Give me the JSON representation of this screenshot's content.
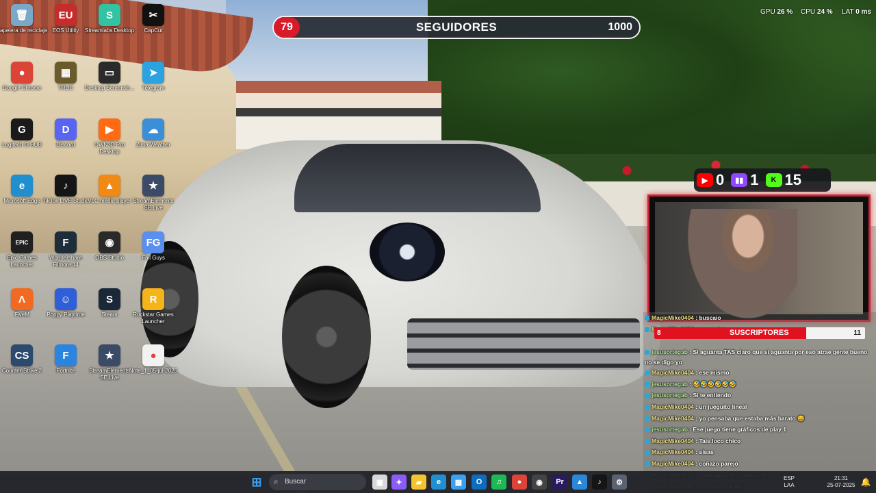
{
  "desktop_icons": [
    {
      "label": "Papelera de reciclaje",
      "icon": "recycle-bin-icon",
      "color": "#7aa8c8",
      "glyph": "🗑"
    },
    {
      "label": "EOS Utility",
      "icon": "eos-utility-icon",
      "color": "#c72c2c",
      "glyph": "EU"
    },
    {
      "label": "Streamlabs Desktop",
      "icon": "streamlabs-icon",
      "color": "#31c3a2",
      "glyph": "S"
    },
    {
      "label": "CapCut",
      "icon": "capcut-icon",
      "color": "#111111",
      "glyph": "✂"
    },
    {
      "label": "Google Chrome",
      "icon": "chrome-icon",
      "color": "#db4437",
      "glyph": "●"
    },
    {
      "label": "TRUC",
      "icon": "truc-icon",
      "color": "#6b5a2c",
      "glyph": "▦"
    },
    {
      "label": "Desktop Screensh...",
      "icon": "screenshot-icon",
      "color": "#2b2b2b",
      "glyph": "▭"
    },
    {
      "label": "Telegram",
      "icon": "telegram-icon",
      "color": "#2aa3e0",
      "glyph": "➤"
    },
    {
      "label": "Logitech G HUB",
      "icon": "logitech-icon",
      "color": "#1a1a1a",
      "glyph": "G"
    },
    {
      "label": "Discord",
      "icon": "discord-icon",
      "color": "#5865f2",
      "glyph": "D"
    },
    {
      "label": "OWN3D Pro Desktop",
      "icon": "own3d-icon",
      "color": "#ff6a13",
      "glyph": "▶"
    },
    {
      "label": "Zima Weather",
      "icon": "weather-icon",
      "color": "#3a8fd8",
      "glyph": "☁"
    },
    {
      "label": "Microsoft Edge",
      "icon": "edge-icon",
      "color": "#1f8fcf",
      "glyph": "e"
    },
    {
      "label": "TikTok LIVE Studio",
      "icon": "tiktok-icon",
      "color": "#151515",
      "glyph": "♪"
    },
    {
      "label": "VLC media player",
      "icon": "vlc-icon",
      "color": "#f08a14",
      "glyph": "▲"
    },
    {
      "label": "StreamElements SE.Live",
      "icon": "streamelements-icon",
      "color": "#3b4a66",
      "glyph": "★"
    },
    {
      "label": "Epic Games Launcher",
      "icon": "epic-games-icon",
      "color": "#202020",
      "glyph": "EPIC"
    },
    {
      "label": "Wondershare Filmora 14",
      "icon": "filmora-icon",
      "color": "#1d2d3a",
      "glyph": "F"
    },
    {
      "label": "OBS Studio",
      "icon": "obs-icon",
      "color": "#2a2a2a",
      "glyph": "◉"
    },
    {
      "label": "Fall Guys",
      "icon": "fall-guys-icon",
      "color": "#5a8ff0",
      "glyph": "FG"
    },
    {
      "label": "FiveM",
      "icon": "fivem-icon",
      "color": "#f26a21",
      "glyph": "Λ"
    },
    {
      "label": "Poppy Playtime",
      "icon": "poppy-playtime-icon",
      "color": "#2f5fd8",
      "glyph": "☺"
    },
    {
      "label": "Steam",
      "icon": "steam-icon",
      "color": "#1b2838",
      "glyph": "S"
    },
    {
      "label": "Rockstar Games Launcher",
      "icon": "rockstar-icon",
      "color": "#f4b41a",
      "glyph": "R"
    },
    {
      "label": "Counter-Strike 2",
      "icon": "counter-strike-icon",
      "color": "#2b4a6e",
      "glyph": "CS"
    },
    {
      "label": "Fortnite",
      "icon": "fortnite-icon",
      "color": "#2a84e0",
      "glyph": "F"
    },
    {
      "label": "StreamElements SE.Live",
      "icon": "streamelements-icon",
      "color": "#3b4a66",
      "glyph": "★"
    },
    {
      "label": "Note_1_05-jul-2025",
      "icon": "chrome-file-icon",
      "color": "#f2f2f2",
      "glyph": "●"
    }
  ],
  "followers_bar": {
    "count": "79",
    "title": "SEGUIDORES",
    "goal": "1000",
    "fill": 0.079
  },
  "stats": {
    "gpu_label": "GPU",
    "gpu": "26 %",
    "cpu_label": "CPU",
    "cpu": "24 %",
    "lat_label": "LAT",
    "lat": "0 ms"
  },
  "socials": [
    {
      "icon": "youtube-icon",
      "value": "0",
      "color": "#ff0000",
      "glyph": "▶"
    },
    {
      "icon": "twitch-icon",
      "value": "1",
      "color": "#9146ff",
      "glyph": "▮▮"
    },
    {
      "icon": "kick-icon",
      "value": "15",
      "color": "#53fc18",
      "glyph": "K"
    }
  ],
  "subs_bar": {
    "count": "8",
    "title": "SUSCRIPTORES",
    "goal": "11",
    "fill": 0.72
  },
  "chat": [
    {
      "user": "MagicMike0404",
      "text": "buscaio"
    },
    {
      "user": "MagicMike0404",
      "text": "que pelea"
    },
    {
      "user": "jesusortegab",
      "text": "Si aguanta TAS claro que si aguanta por eso atrae gente bueno no se digo yo"
    },
    {
      "user": "MagicMike0404",
      "text": "ese mismo"
    },
    {
      "user": "jesusortegab",
      "text": "🤣🤣🤣🤣🤣🤣"
    },
    {
      "user": "jesusortegab",
      "text": "Si te entiendo"
    },
    {
      "user": "MagicMike0404",
      "text": "un jueguito lineal"
    },
    {
      "user": "MagicMike0404",
      "text": "yo pensaba que estaba más barato 😅"
    },
    {
      "user": "jesusortegab",
      "text": "Ese juego tiene gráficos de play 1"
    },
    {
      "user": "MagicMike0404",
      "text": "Tais loco chico"
    },
    {
      "user": "MagicMike0404",
      "text": "sisas"
    },
    {
      "user": "MagicMike0404",
      "text": "coñazo parejo"
    },
    {
      "user": "MagicMike0404",
      "text": "pero que estás buscando?"
    },
    {
      "user": "MagicMike0404",
      "text": "es corto el juego"
    }
  ],
  "taskbar": {
    "search_placeholder": "Buscar",
    "apps": [
      {
        "icon": "windows-start-icon",
        "glyph": "⊞",
        "color": "#3aa0f0"
      },
      {
        "icon": "task-view-icon",
        "glyph": "▣",
        "color": "#d8d8d8"
      },
      {
        "icon": "copilot-icon",
        "glyph": "✦",
        "color": "#8b5cf6"
      },
      {
        "icon": "file-explorer-icon",
        "glyph": "▰",
        "color": "#f4c430"
      },
      {
        "icon": "edge-icon",
        "glyph": "e",
        "color": "#1f8fcf"
      },
      {
        "icon": "microsoft-store-icon",
        "glyph": "▦",
        "color": "#3aa0f0"
      },
      {
        "icon": "outlook-icon",
        "glyph": "O",
        "color": "#0f6cbd"
      },
      {
        "icon": "spotify-icon",
        "glyph": "♫",
        "color": "#1db954"
      },
      {
        "icon": "chrome-icon",
        "glyph": "●",
        "color": "#db4437"
      },
      {
        "icon": "obs-icon",
        "glyph": "◉",
        "color": "#444444"
      },
      {
        "icon": "premiere-icon",
        "glyph": "Pr",
        "color": "#2a1a5e"
      },
      {
        "icon": "photos-icon",
        "glyph": "▲",
        "color": "#2b88d8"
      },
      {
        "icon": "tiktok-icon",
        "glyph": "♪",
        "color": "#151515"
      },
      {
        "icon": "settings-icon",
        "glyph": "⚙",
        "color": "#5a6270"
      }
    ],
    "language": "ESP",
    "layout": "LAA",
    "time": "21:31",
    "date": "25-07-2025"
  }
}
